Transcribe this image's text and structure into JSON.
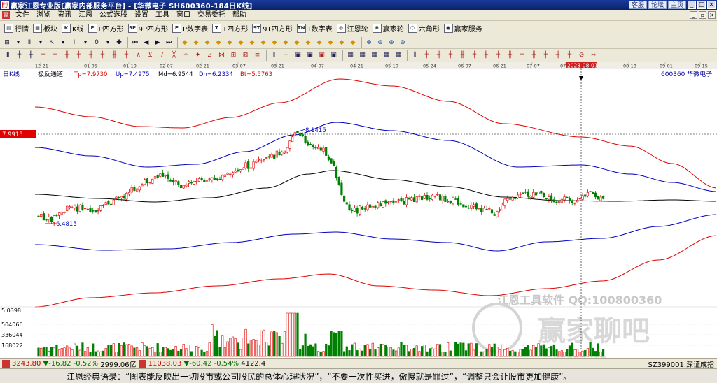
{
  "window": {
    "title": "赢家江恩专业版[赢家内部服务平台] - [华微电子  SH600360-184日K线]",
    "buttons": [
      "客服",
      "论坛",
      "主页"
    ]
  },
  "menu": [
    "文件",
    "浏览",
    "资讯",
    "江恩",
    "公式选股",
    "设置",
    "工具",
    "窗口",
    "交易委托",
    "帮助"
  ],
  "toolbar1": [
    {
      "icon": "quote-icon",
      "label": "行情"
    },
    {
      "icon": "sector-icon",
      "label": "板块"
    },
    {
      "icon": "kline-icon",
      "label": "K线"
    },
    {
      "icon": "p-square-icon",
      "label": "P四方形"
    },
    {
      "icon": "9p-square-icon",
      "label": "9P四方形"
    },
    {
      "icon": "p-number-icon",
      "label": "P数字表"
    },
    {
      "icon": "t-square-icon",
      "label": "T四方形"
    },
    {
      "icon": "9t-square-icon",
      "label": "9T四方形"
    },
    {
      "icon": "t-number-icon",
      "label": "T数字表"
    },
    {
      "icon": "gann-wheel-icon",
      "label": "江恩轮"
    },
    {
      "icon": "winner-wheel-icon",
      "label": "赢家轮"
    },
    {
      "icon": "hexagon-icon",
      "label": "六角形"
    },
    {
      "icon": "service-icon",
      "label": "赢家服务"
    }
  ],
  "chart": {
    "period_label": "日K线",
    "indicator": {
      "name": "极反通道",
      "Tp": "Tp=7.9730",
      "Up": "Up=7.4975",
      "Md": "Md=6.9544",
      "Dn": "Dn=6.2334",
      "Bt": "Bt=5.5763"
    },
    "stock": "600360  华微电子",
    "price_marker": "7.9915",
    "high_label": "8.1415",
    "low_label": "6.4815",
    "cursor_date": "2023-08-01",
    "dates": [
      "12-21",
      "01-05",
      "01-19",
      "02-07",
      "02-21",
      "03-07",
      "03-21",
      "04-07",
      "04-21",
      "05-10",
      "05-24",
      "06-07",
      "06-21",
      "07-07",
      "07-21",
      "2023-08-01",
      "08-18",
      "09-01",
      "09-15"
    ],
    "volume_axis": [
      "5.0398",
      "504066",
      "336044",
      "168022"
    ],
    "colors": {
      "up": "#e00000",
      "down": "#008000",
      "top_band": "#e00000",
      "mid_band": "#0000c0",
      "median": "#000000"
    },
    "watermark_line1": "江恩工具软件  QQ:100800360",
    "watermark_line2": "赢家聊吧",
    "watermark_line3": "liaoba.vip"
  },
  "statusbar": {
    "sh_index": "3243.80",
    "sh_change": "▼-16.82",
    "sh_pct": "-0.52%",
    "sh_amount": "2999.06亿",
    "sz_index": "11038.03",
    "sz_change": "▼-60.42",
    "sz_pct": "-0.54%",
    "sz_amount": "4122.4",
    "right_text": "SZ399001.深证成指"
  },
  "ticker": "江恩经典语录：“图表能反映出一切股市或公司股民的总体心理状况”，“不要一次性买进，傲慢就是罪过”，“调整只会让股市更加健康”。"
}
